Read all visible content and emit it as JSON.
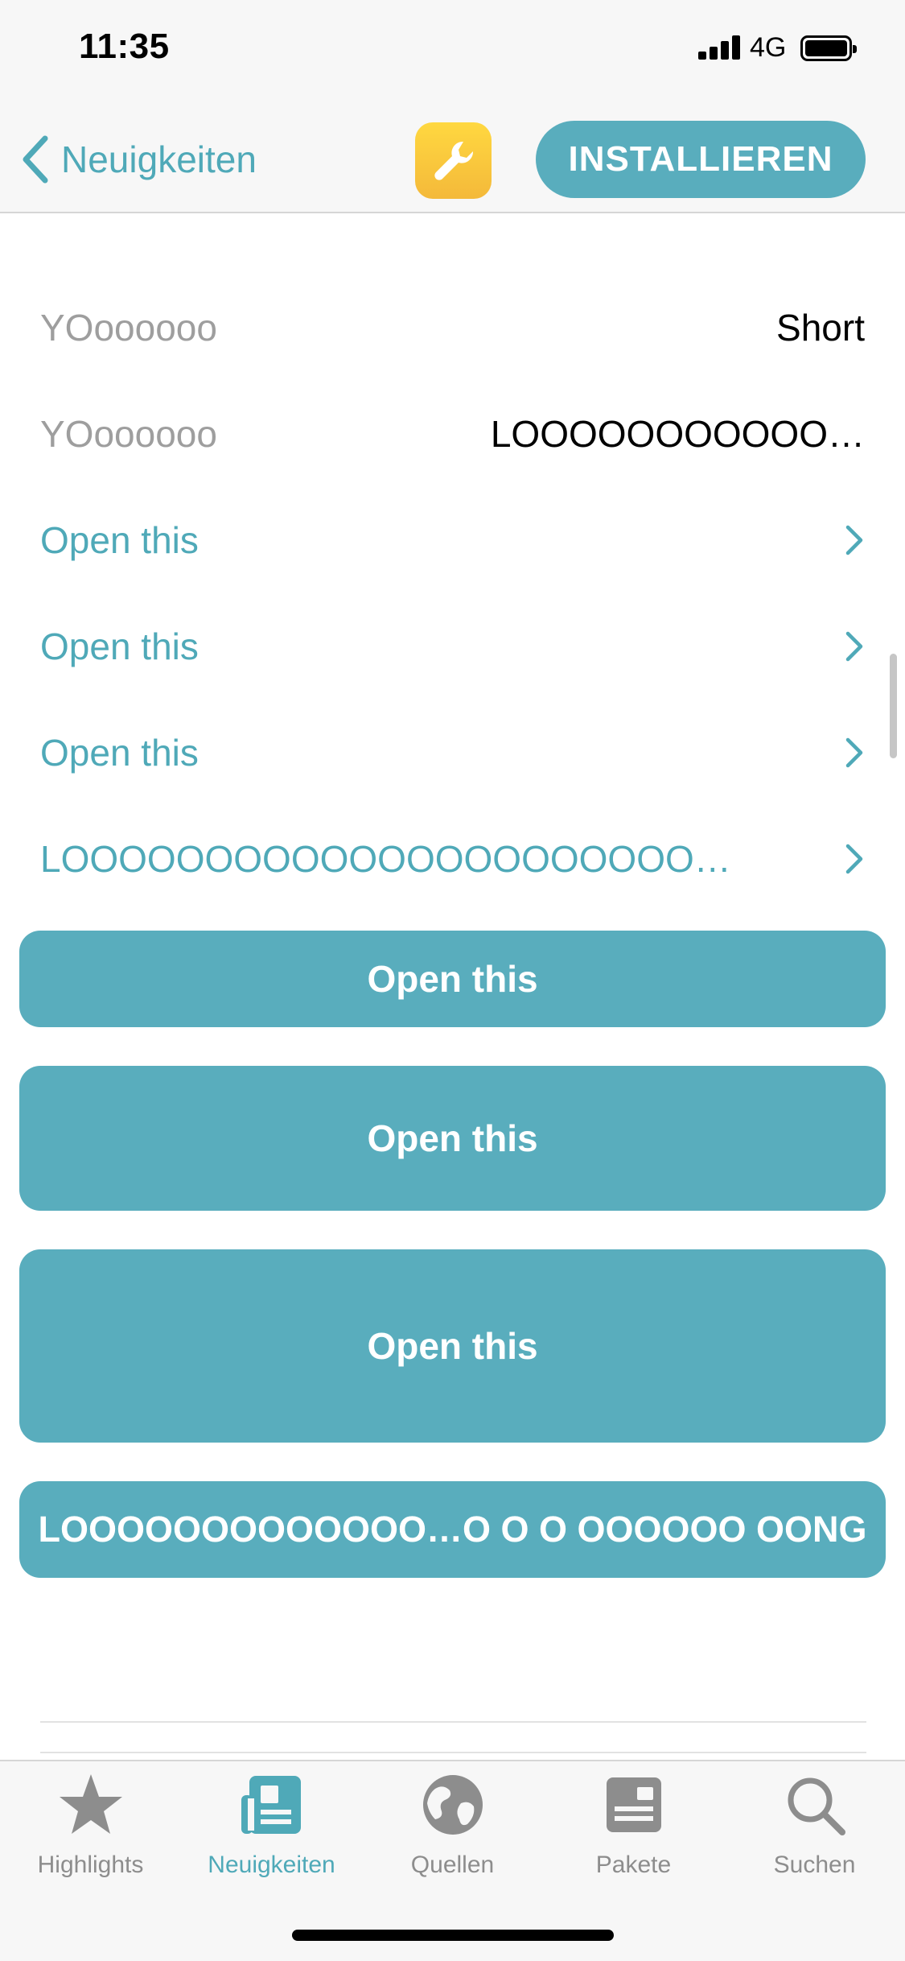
{
  "status_bar": {
    "time": "11:35",
    "network": "4G"
  },
  "nav": {
    "back_label": "Neuigkeiten",
    "install_label": "INSTALLIEREN",
    "icon": "wrench-icon"
  },
  "info_rows": [
    {
      "key": "YOoooooo",
      "value": "Short"
    },
    {
      "key": "YOoooooo",
      "value": "LOOOOOOOOOOO…"
    }
  ],
  "link_rows": [
    {
      "label": "Open this"
    },
    {
      "label": "Open this"
    },
    {
      "label": "Open this"
    },
    {
      "label": "LOOOOOOOOOOOOOOOOOOOOOO…"
    }
  ],
  "buttons": [
    {
      "label": "Open this"
    },
    {
      "label": "Open this"
    },
    {
      "label": "Open this"
    },
    {
      "label": "LOOOOOOOOOOOOO…O O O OOOOOO OONG"
    }
  ],
  "tabs": [
    {
      "label": "Highlights",
      "icon": "star-icon",
      "active": false
    },
    {
      "label": "Neuigkeiten",
      "icon": "news-icon",
      "active": true
    },
    {
      "label": "Quellen",
      "icon": "globe-icon",
      "active": false
    },
    {
      "label": "Pakete",
      "icon": "package-icon",
      "active": false
    },
    {
      "label": "Suchen",
      "icon": "search-icon",
      "active": false
    }
  ],
  "colors": {
    "accent": "#59adbd",
    "link": "#4fa9b8",
    "app_icon": "#f8c93c"
  }
}
